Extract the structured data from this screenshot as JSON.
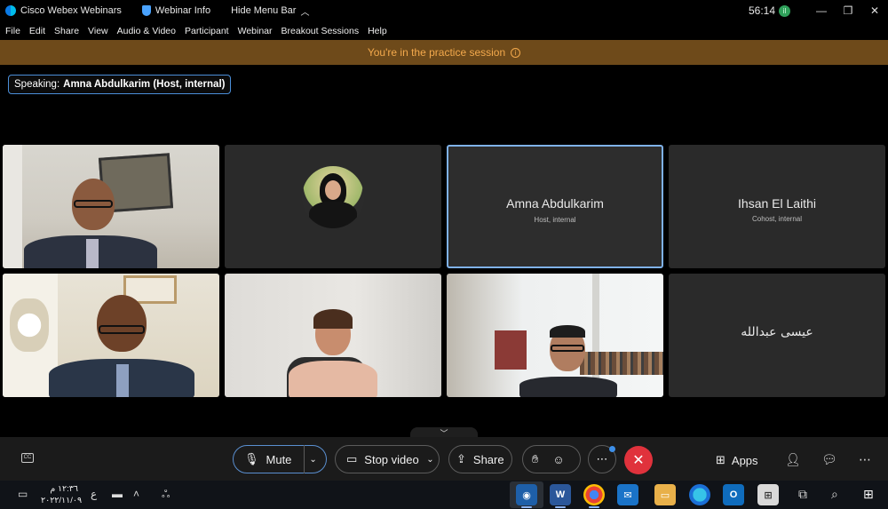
{
  "titlebar": {
    "app_name": "Cisco Webex Webinars",
    "webinar_info": "Webinar Info",
    "hide_menu": "Hide Menu Bar",
    "timer": "56:14",
    "rec_badge": "il"
  },
  "menu": [
    "File",
    "Edit",
    "Share",
    "View",
    "Audio & Video",
    "Participant",
    "Webinar",
    "Breakout Sessions",
    "Help"
  ],
  "banner": {
    "text": "You're in the practice session"
  },
  "speaking": {
    "label": "Speaking:",
    "name": "Amna Abdulkarim (Host, internal)"
  },
  "tiles": [
    {
      "type": "video",
      "scene": "man-office"
    },
    {
      "type": "avatar"
    },
    {
      "type": "name",
      "name": "Amna Abdulkarim",
      "role": "Host, internal",
      "active": true
    },
    {
      "type": "name",
      "name": "Ihsan El Laithi",
      "role": "Cohost, internal"
    },
    {
      "type": "video",
      "scene": "man-smiling"
    },
    {
      "type": "video",
      "scene": "woman"
    },
    {
      "type": "video",
      "scene": "man-window"
    },
    {
      "type": "name",
      "name": "عيسى عبدالله",
      "role": ""
    }
  ],
  "controls": {
    "mute": "Mute",
    "stop_video": "Stop video",
    "share": "Share",
    "apps": "Apps",
    "cc": "CC"
  },
  "taskbar": {
    "time": "١٢:٣٦ م",
    "date": "٢٠٢٢/١١/٠٩",
    "lang": "ع"
  },
  "colors": {
    "banner_bg": "#6e4a1a",
    "banner_text": "#f3a94c",
    "leave": "#e0323c",
    "active_border": "#7fb1e8"
  }
}
